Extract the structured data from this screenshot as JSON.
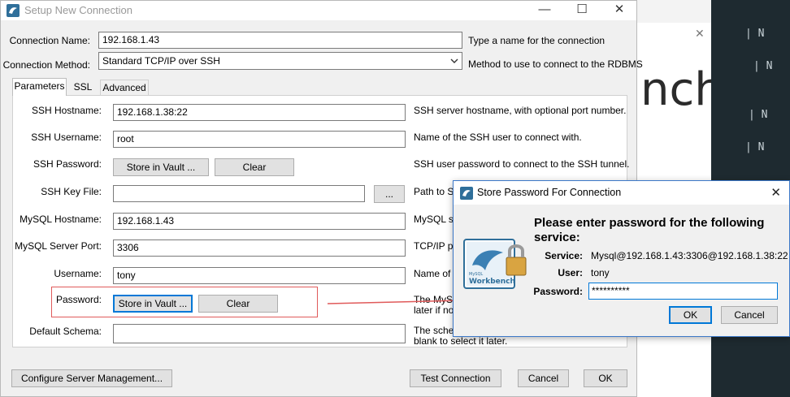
{
  "main_window": {
    "title": "Setup New Connection",
    "controls": {
      "minimize": "—",
      "maximize": "☐",
      "close": "✕"
    }
  },
  "form": {
    "connection_name": {
      "label": "Connection Name:",
      "value": "192.168.1.43",
      "hint": "Type a name for the connection"
    },
    "connection_method": {
      "label": "Connection Method:",
      "value": "Standard TCP/IP over SSH",
      "hint": "Method to use to connect to the RDBMS"
    }
  },
  "tabs": [
    "Parameters",
    "SSL",
    "Advanced"
  ],
  "params": {
    "ssh_hostname": {
      "label": "SSH Hostname:",
      "value": "192.168.1.38:22",
      "hint": "SSH server hostname, with  optional port number."
    },
    "ssh_username": {
      "label": "SSH Username:",
      "value": "root",
      "hint": "Name of the SSH user to connect with."
    },
    "ssh_password": {
      "label": "SSH Password:",
      "store_label": "Store in Vault ...",
      "clear_label": "Clear",
      "hint": "SSH user password to connect to the SSH tunnel."
    },
    "ssh_key_file": {
      "label": "SSH Key File:",
      "value": "",
      "browse_label": "...",
      "hint": "Path to SS"
    },
    "mysql_hostname": {
      "label": "MySQL Hostname:",
      "value": "192.168.1.43",
      "hint": "MySQL se"
    },
    "mysql_port": {
      "label": "MySQL Server Port:",
      "value": "3306",
      "hint": "TCP/IP po"
    },
    "username": {
      "label": "Username:",
      "value": "tony",
      "hint": "Name of t"
    },
    "password": {
      "label": "Password:",
      "store_label": "Store in Vault ...",
      "clear_label": "Clear",
      "hint_line1": "The MySQ",
      "hint_line2": "later if no"
    },
    "default_schema": {
      "label": "Default Schema:",
      "value": "",
      "hint_line1": "The schem",
      "hint_line2": "blank to select it later."
    }
  },
  "footer": {
    "configure_label": "Configure Server Management...",
    "test_label": "Test Connection",
    "cancel_label": "Cancel",
    "ok_label": "OK"
  },
  "dialog": {
    "title": "Store Password For Connection",
    "close": "✕",
    "heading": "Please enter password for the following service:",
    "service_label": "Service:",
    "service_value": "Mysql@192.168.1.43:3306@192.168.1.38:22",
    "user_label": "User:",
    "user_value": "tony",
    "password_label": "Password:",
    "password_value": "**********",
    "ok_label": "OK",
    "cancel_label": "Cancel",
    "logo_text_small": "MySQL",
    "logo_text": "Workbench"
  },
  "background": {
    "big_text": "nch",
    "close": "✕",
    "side_labels": [
      "| N",
      "| N",
      "| N",
      "| N"
    ]
  },
  "colors": {
    "highlight": "#e05a5a",
    "focus": "#0078d7",
    "dark_panel": "#1e2a30"
  }
}
